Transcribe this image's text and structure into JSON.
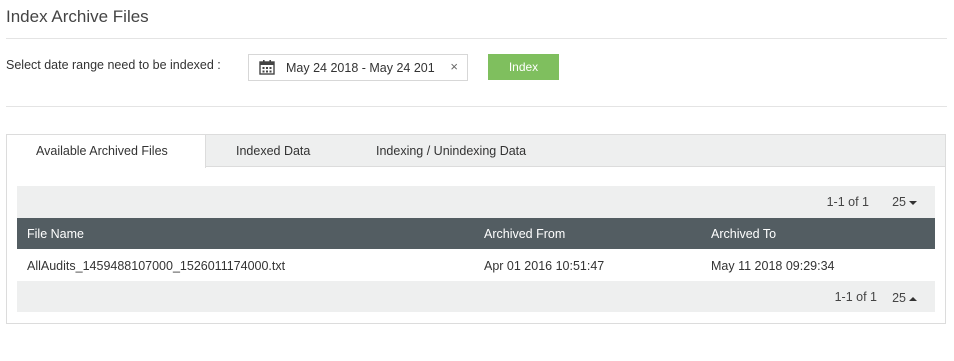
{
  "page": {
    "title": "Index Archive Files"
  },
  "date_range": {
    "label": "Select date range need to be indexed :",
    "value": "May 24 2018 - May 24 201",
    "clear_glyph": "×",
    "icon": "calendar-icon"
  },
  "index_button": {
    "label": "Index",
    "color": "#7fbf5e"
  },
  "tabs": [
    {
      "label": "Available Archived Files",
      "active": true
    },
    {
      "label": "Indexed Data",
      "active": false
    },
    {
      "label": "Indexing / Unindexing Data",
      "active": false
    }
  ],
  "pager_top": {
    "range": "1-1 of 1",
    "page_size": "25"
  },
  "table": {
    "header_color": "#535d62",
    "columns": [
      "File Name",
      "Archived From",
      "Archived To"
    ],
    "rows": [
      [
        "AllAudits_1459488107000_1526011174000.txt",
        "Apr 01 2016 10:51:47",
        "May 11 2018 09:29:34"
      ]
    ]
  },
  "pager_bottom": {
    "range": "1-1 of 1",
    "page_size": "25"
  }
}
